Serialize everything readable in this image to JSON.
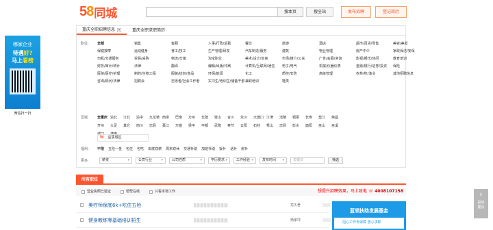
{
  "header": {
    "logo_num_5": "5",
    "logo_num_8": "8",
    "logo_text": "同城",
    "search_placeholder": "",
    "search_button": "搜本页",
    "search_site_button": "搜全站",
    "post_job_button": "发布招聘",
    "register_resume_button": "登记简历"
  },
  "ad": {
    "line1": "哪家企业",
    "line2a": "待遇",
    "line2b": "好?",
    "line3a": "马上",
    "line3b": "看榜",
    "caption": "微信扫一扫"
  },
  "tabs": [
    "重庆全职招聘信息",
    "重庆全职求职简历"
  ],
  "position": {
    "label": "职位:",
    "items": [
      "全部",
      "销售",
      "客服",
      "人事/行政/后勤",
      "餐饮",
      "旅游",
      "酒店",
      "超市/百货/零售",
      "美容/美发",
      "保健按摩",
      "运动健身",
      "普工/技工",
      "生产管理/研发",
      "汽车制造/服务",
      "建筑",
      "物业管理",
      "房产中介",
      "家政保洁/安保",
      "司机/交通服务",
      "贸易/采购",
      "物流/仓储",
      "淘宝职位",
      "美术/设计/创意",
      "市场/媒介/公关",
      "广告/会展/咨询",
      "影视/娱乐/休闲",
      "教育培训",
      "财务/审计/统计",
      "法律",
      "翻译",
      "编辑/出版/印刷",
      "计算机/互联网/通信",
      "电子/电气",
      "机械/仪器仪表",
      "金融/银行/证券/投资",
      "保险",
      "医院/医疗/护理",
      "制药/生物工程",
      "服装/纺织/食品",
      "环保/能源",
      "化工",
      "质控/安防",
      "高级管理",
      "农林/牧/渔业",
      "其他招聘信息",
      "咨询/顾问/法律",
      "招聘会",
      "志愿者/社会工作者",
      "实习生/培训生/储备干部",
      "兼职培训",
      "鞋类"
    ]
  },
  "area": {
    "label": "区域:",
    "items": [
      "全重庆",
      "渝北",
      "江北",
      "渝中",
      "九龙坡",
      "南岸",
      "巴南",
      "万州",
      "北碚",
      "璧山",
      "合川",
      "永川",
      "大渡口",
      "江津",
      "涪陵",
      "铜梁",
      "长寿",
      "垫江",
      "荣昌",
      "开州",
      "大足",
      "其它",
      "南川",
      "忠县",
      "綦江",
      "万盛",
      "梁平",
      "丰都",
      "武隆",
      "奉节",
      "云阳",
      "石柱",
      "秀山",
      "忠县",
      "彭水",
      "酉阳",
      "巫山",
      "巫溪",
      "城口",
      "潼南"
    ],
    "district_tag": "W",
    "district_label": "巫溪城区"
  },
  "welfare": {
    "label": "福利:",
    "items": [
      "不限",
      "五险一金",
      "包住",
      "包吃",
      "年底双薪",
      "周末双休",
      "交通补助",
      "加班补助",
      "饭补",
      "话补",
      "房补"
    ]
  },
  "more": {
    "label": "更多:",
    "selects": [
      "薪资",
      "公司行业",
      "公司性质",
      "学历要求",
      "工作经验",
      "发布时间"
    ],
    "keyword_placeholder": "关键词",
    "filter_button": "筛选"
  },
  "listing": {
    "section_title": "所有职位",
    "opt1": "营业执照已验证",
    "opt2": "帮帮在线",
    "opt3": "只看本地工作",
    "promo": "想提升招聘效果，马上致电",
    "phone": "4008107158",
    "jobs": [
      {
        "title": "美疗师保底6k+吃住五险",
        "company": "龙头舍"
      },
      {
        "title": "健身教练零基础培训招生",
        "company": "杨家坪"
      }
    ]
  },
  "side_ad": {
    "title": "蓝领扶助发展基金",
    "body": "招心工作专保障 放心求职"
  },
  "feedback": {
    "label1": "投诉",
    "label2": "建议"
  }
}
